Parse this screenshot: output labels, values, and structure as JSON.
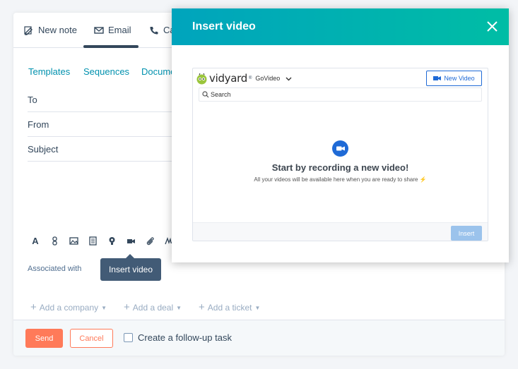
{
  "tabs": [
    {
      "label": "New note",
      "icon": "pencil-icon"
    },
    {
      "label": "Email",
      "icon": "envelope-icon",
      "active": true
    },
    {
      "label": "Ca",
      "icon": "phone-icon"
    }
  ],
  "subtabs": [
    "Templates",
    "Sequences",
    "Docume"
  ],
  "fields": {
    "to": "To",
    "from": "From",
    "subject": "Subject"
  },
  "toolbar_icons": [
    "text-style-icon",
    "link-icon",
    "image-icon",
    "snippet-icon",
    "knowledge-icon",
    "video-icon",
    "attachment-icon",
    "signature-icon"
  ],
  "associated_label": "Associated with",
  "tooltip": "Insert video",
  "add_links": {
    "company": "Add a company",
    "deal": "Add a deal",
    "ticket": "Add a ticket"
  },
  "footer": {
    "send": "Send",
    "cancel": "Cancel",
    "followup": "Create a follow-up task"
  },
  "modal": {
    "title": "Insert video",
    "vidyard": {
      "brand": "vidyard",
      "product": "GoVideo",
      "new_video": "New Video",
      "search_placeholder": "Search",
      "headline": "Start by recording a new video!",
      "subtext": "All your videos will be available here when you are ready to share",
      "insert": "Insert"
    }
  },
  "colors": {
    "accent_teal": "#00a4bd",
    "brand_orange": "#ff7a59",
    "vidyard_blue": "#1f6ad6",
    "text_dark": "#33475b",
    "link": "#0091ae"
  }
}
